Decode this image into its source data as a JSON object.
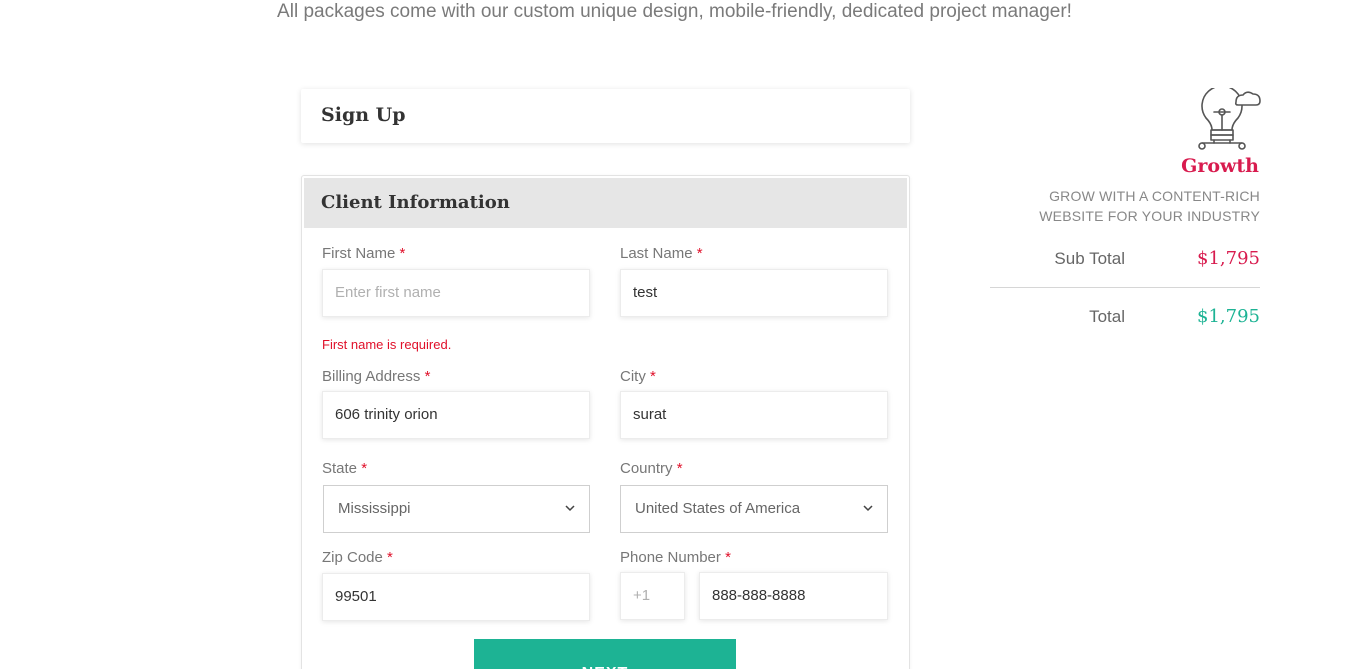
{
  "header": {
    "tagline": "All packages come with our custom unique design, mobile-friendly, dedicated project manager!"
  },
  "signup": {
    "title": "Sign Up"
  },
  "client_info": {
    "title": "Client Information",
    "first_name": {
      "label": "First Name",
      "value": "",
      "placeholder": "Enter first name",
      "error": "First name is required."
    },
    "last_name": {
      "label": "Last Name",
      "value": "test"
    },
    "billing_address": {
      "label": "Billing Address",
      "value": "606 trinity orion"
    },
    "city": {
      "label": "City",
      "value": "surat"
    },
    "state": {
      "label": "State",
      "value": "Mississippi"
    },
    "country": {
      "label": "Country",
      "value": "United States of America"
    },
    "zip": {
      "label": "Zip Code",
      "value": "99501"
    },
    "phone": {
      "label": "Phone Number",
      "code": "+1",
      "value": "888-888-8888"
    },
    "required_mark": "*",
    "next_label": "NEXT"
  },
  "summary": {
    "icon": "lightbulb-cloud-icon",
    "package_name": "Growth",
    "package_desc": "GROW WITH A CONTENT-RICH WEBSITE FOR YOUR INDUSTRY",
    "subtotal_label": "Sub Total",
    "subtotal_value": "$1,795",
    "total_label": "Total",
    "total_value": "$1,795"
  },
  "colors": {
    "accent_green": "#1db394",
    "accent_red": "#d81b4e",
    "error_red": "#e0102a"
  }
}
